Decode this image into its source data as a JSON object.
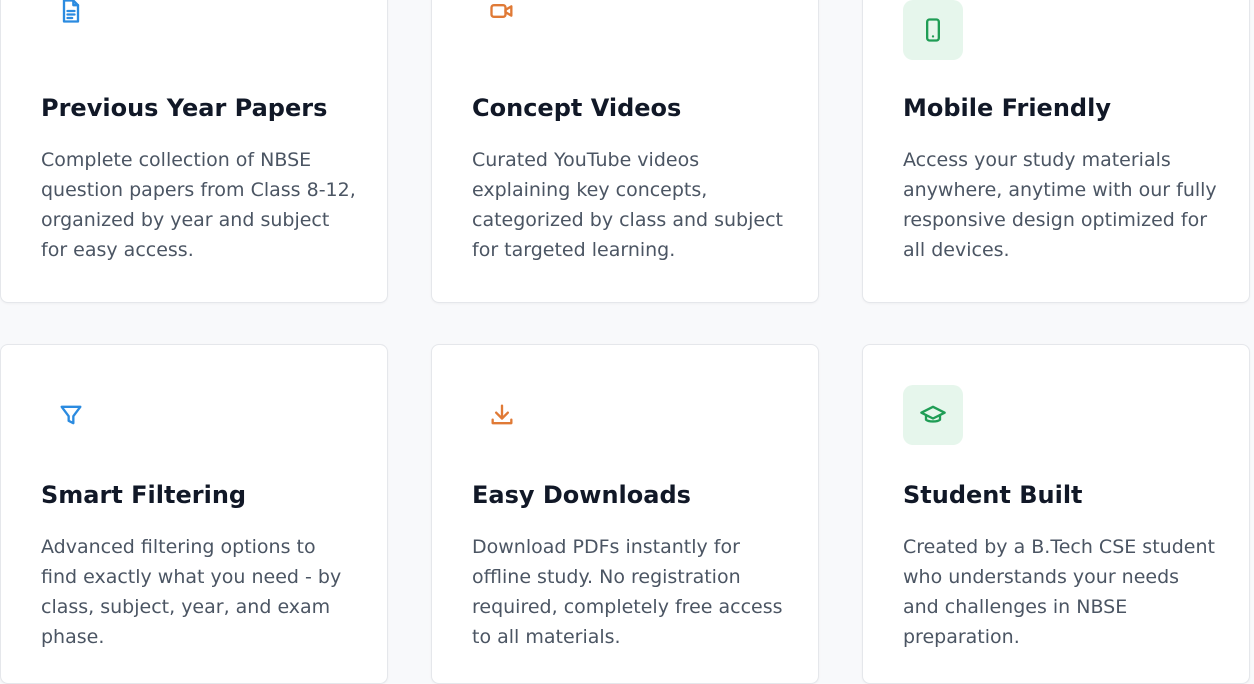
{
  "features": [
    {
      "title": "Previous Year Papers",
      "description": "Complete collection of NBSE question papers from Class 8-12, organized by year and subject for easy access.",
      "icon": "document-icon",
      "icon_color": "#2b8be0",
      "tile_color": "#ffffff"
    },
    {
      "title": "Concept Videos",
      "description": "Curated YouTube videos explaining key concepts, categorized by class and subject for targeted learning.",
      "icon": "video-camera-icon",
      "icon_color": "#e07a36",
      "tile_color": "#ffffff"
    },
    {
      "title": "Mobile Friendly",
      "description": "Access your study materials anywhere, anytime with our fully responsive design optimized for all devices.",
      "icon": "mobile-phone-icon",
      "icon_color": "#1f9d55",
      "tile_color": "#e6f6ec"
    },
    {
      "title": "Smart Filtering",
      "description": "Advanced filtering options to find exactly what you need - by class, subject, year, and exam phase.",
      "icon": "filter-icon",
      "icon_color": "#2b8be0",
      "tile_color": "#ffffff"
    },
    {
      "title": "Easy Downloads",
      "description": "Download PDFs instantly for offline study. No registration required, completely free access to all materials.",
      "icon": "download-icon",
      "icon_color": "#e07a36",
      "tile_color": "#ffffff"
    },
    {
      "title": "Student Built",
      "description": "Created by a B.Tech CSE student who understands your needs and challenges in NBSE preparation.",
      "icon": "graduation-cap-icon",
      "icon_color": "#1f9d55",
      "tile_color": "#e6f6ec"
    }
  ]
}
